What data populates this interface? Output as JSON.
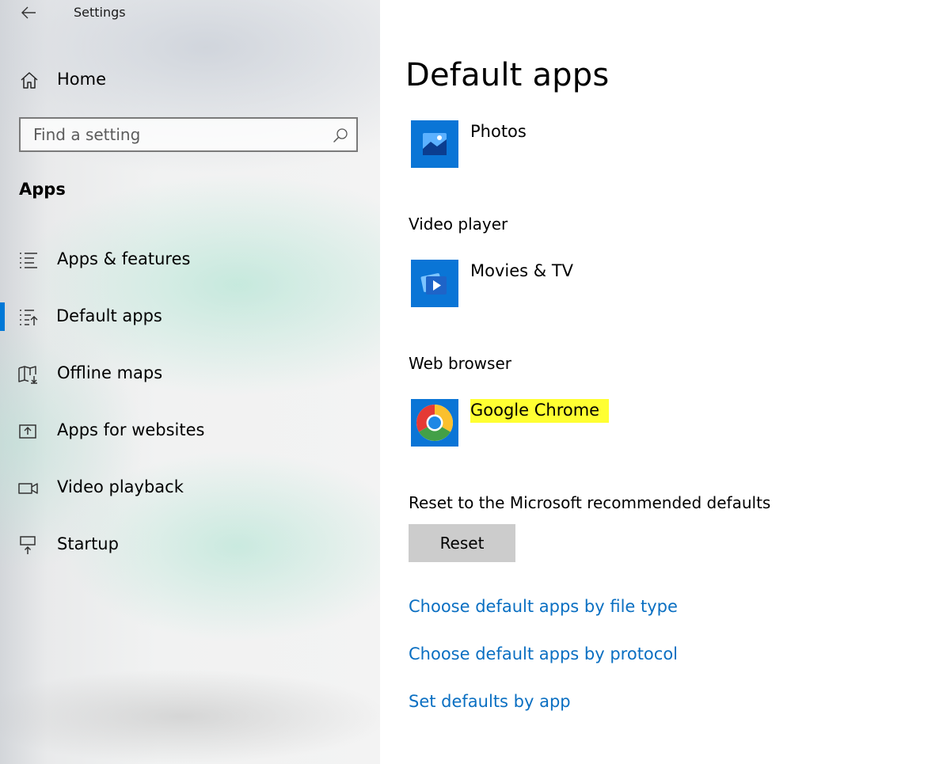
{
  "window": {
    "title": "Settings"
  },
  "sidebar": {
    "home_label": "Home",
    "search": {
      "placeholder": "Find a setting",
      "value": ""
    },
    "section_title": "Apps",
    "items": [
      {
        "label": "Apps & features",
        "icon": "list-icon",
        "selected": false
      },
      {
        "label": "Default apps",
        "icon": "default-apps-icon",
        "selected": true
      },
      {
        "label": "Offline maps",
        "icon": "map-download-icon",
        "selected": false
      },
      {
        "label": "Apps for websites",
        "icon": "open-in-app-icon",
        "selected": false
      },
      {
        "label": "Video playback",
        "icon": "video-camera-icon",
        "selected": false
      },
      {
        "label": "Startup",
        "icon": "startup-icon",
        "selected": false
      }
    ]
  },
  "main": {
    "page_title": "Default apps",
    "photo_viewer": {
      "app_name": "Photos",
      "icon": "photos-icon"
    },
    "video_player": {
      "label": "Video player",
      "app_name": "Movies & TV",
      "icon": "movies-tv-icon"
    },
    "web_browser": {
      "label": "Web browser",
      "app_name": "Google Chrome",
      "icon": "chrome-icon"
    },
    "reset": {
      "label": "Reset to the Microsoft recommended defaults",
      "button_label": "Reset"
    },
    "links": [
      "Choose default apps by file type",
      "Choose default apps by protocol",
      "Set defaults by app"
    ]
  },
  "colors": {
    "accent": "#0078d7",
    "tile_background": "#0a75d6",
    "link": "#0a6fc2",
    "highlight": "#ffff32",
    "reset_button": "#cccccc"
  }
}
